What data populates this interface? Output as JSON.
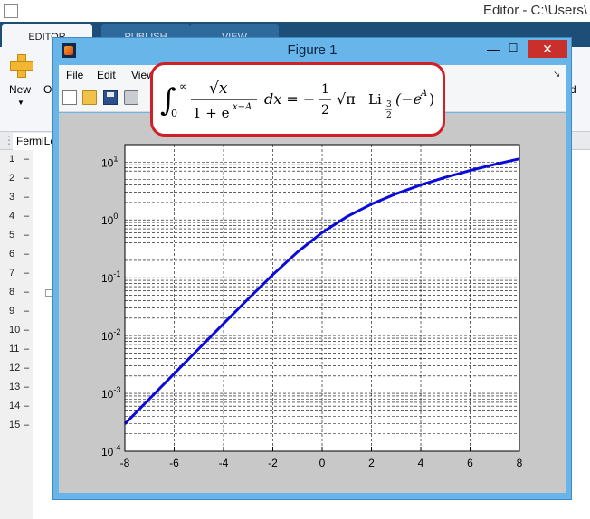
{
  "app": {
    "title": "Editor - C:\\Users\\"
  },
  "ribbon": {
    "tabs": [
      {
        "label": "EDITOR"
      },
      {
        "label": "PUBLISH"
      },
      {
        "label": "VIEW"
      }
    ],
    "new_label": "New",
    "open_partial": "O",
    "right_partial": "d"
  },
  "editor": {
    "doc_tab": "FermiLe",
    "line_numbers": [
      "1",
      "2",
      "3",
      "4",
      "5",
      "6",
      "7",
      "8",
      "9",
      "10",
      "11",
      "12",
      "13",
      "14",
      "15"
    ]
  },
  "figure": {
    "title": "Figure 1",
    "menus": [
      "File",
      "Edit",
      "View"
    ],
    "toolbar_icons": [
      "new-file-icon",
      "open-folder-icon",
      "save-icon",
      "print-icon"
    ]
  },
  "formula": {
    "integral_upper": "∞",
    "integral_lower": "0",
    "numerator": "√x",
    "denominator": "1 + e",
    "denominator_exp": "x−A",
    "dx": "dx = −",
    "half_num": "1",
    "half_den": "2",
    "sqrt_pi": "√π",
    "polylog": "Li",
    "polylog_num": "3",
    "polylog_den": "2",
    "polylog_arg": "(−e",
    "polylog_arg_exp": "A",
    "polylog_close": ")"
  },
  "chart_data": {
    "type": "line",
    "x_ticks": [
      "-8",
      "-6",
      "-4",
      "-2",
      "0",
      "2",
      "4",
      "6",
      "8"
    ],
    "y_ticks": [
      {
        "base": "10",
        "exp": "1"
      },
      {
        "base": "10",
        "exp": "0"
      },
      {
        "base": "10",
        "exp": "-1"
      },
      {
        "base": "10",
        "exp": "-2"
      },
      {
        "base": "10",
        "exp": "-3"
      },
      {
        "base": "10",
        "exp": "-4"
      }
    ],
    "xlim": [
      -8,
      8
    ],
    "ylim": [
      0.0001,
      20
    ],
    "yscale": "log",
    "grid": true,
    "series": [
      {
        "color": "#0a0adc",
        "x": [
          -8,
          -7,
          -6,
          -5,
          -4,
          -3,
          -2,
          -1,
          0,
          1,
          2,
          3,
          4,
          5,
          6,
          7,
          8
        ],
        "y": [
          0.000297,
          0.000808,
          0.002195,
          0.005955,
          0.01611,
          0.04318,
          0.1129,
          0.2782,
          0.6049,
          1.134,
          1.874,
          2.83,
          4.016,
          5.449,
          7.145,
          9.116,
          11.37
        ]
      }
    ]
  },
  "colors": {
    "figure_frame": "#68b5ea",
    "callout_border": "#d01f26",
    "close_button": "#c9302c"
  }
}
